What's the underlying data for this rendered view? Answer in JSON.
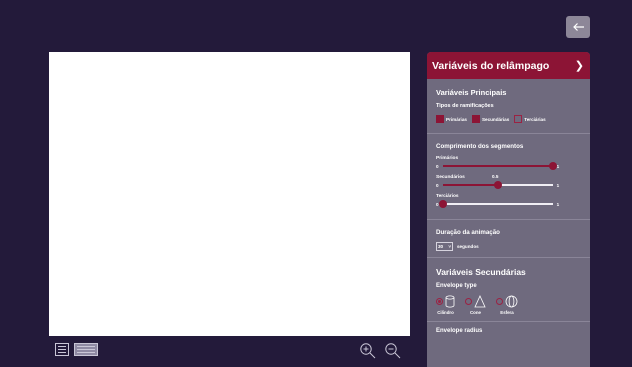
{
  "panel": {
    "title": "Variáveis do relâmpago",
    "main_section": "Variáveis Principais",
    "branch_types_label": "Tipos de ramificações",
    "branch_types": [
      {
        "label": "Primárias",
        "checked": true
      },
      {
        "label": "Secundárias",
        "checked": true
      },
      {
        "label": "Terciárias",
        "checked": false
      }
    ],
    "segments_label": "Comprimento dos segmentos",
    "sliders": [
      {
        "label": "Primários",
        "min": "0",
        "max": "1",
        "value": 1.0,
        "value_label": ""
      },
      {
        "label": "Secundários",
        "min": "0",
        "max": "1",
        "value": 0.5,
        "value_label": "0.5"
      },
      {
        "label": "Terciários",
        "min": "0",
        "max": "1",
        "value": 0.0,
        "value_label": ""
      }
    ],
    "duration_label": "Duração da animação",
    "duration_value": "30",
    "duration_unit": "segundos",
    "secondary_section": "Variáveis Secundárias",
    "envelope_type_label": "Envelope type",
    "envelopes": [
      {
        "label": "Cilindro",
        "selected": true
      },
      {
        "label": "Cone",
        "selected": false
      },
      {
        "label": "Esfera",
        "selected": false
      }
    ],
    "cut_label": "Envelope radius"
  },
  "colors": {
    "accent": "#8c1435",
    "panel": "#6f6a7e",
    "background": "#231a3a"
  }
}
